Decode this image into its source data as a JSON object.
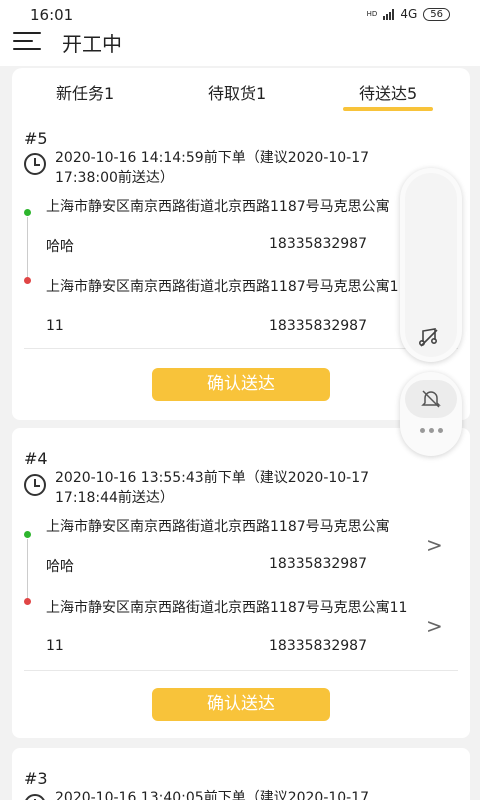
{
  "status_bar": {
    "time": "16:01",
    "hd": "HD",
    "network": "4G",
    "battery": "56"
  },
  "header": {
    "title": "开工中",
    "menu_icon": "hamburger-menu-icon"
  },
  "tabs": [
    {
      "label": "新任务1",
      "active": false
    },
    {
      "label": "待取货1",
      "active": false
    },
    {
      "label": "待送达5",
      "active": true
    }
  ],
  "orders": [
    {
      "number": "#5",
      "time_text": "2020-10-16 14:14:59前下单（建议2020-10-17 17:38:00前送达）",
      "pickup": {
        "address": "上海市静安区南京西路街道北京西路1187号马克思公寓",
        "name": "哈哈",
        "phone": "18335832987"
      },
      "delivery": {
        "address": "上海市静安区南京西路街道北京西路1187号马克思公寓11",
        "name": "11",
        "phone": "18335832987"
      },
      "button_label": "确认送达"
    },
    {
      "number": "#4",
      "time_text": "2020-10-16 13:55:43前下单（建议2020-10-17 17:18:44前送达）",
      "pickup": {
        "address": "上海市静安区南京西路街道北京西路1187号马克思公寓",
        "name": "哈哈",
        "phone": "18335832987"
      },
      "delivery": {
        "address": "上海市静安区南京西路街道北京西路1187号马克思公寓11",
        "name": "11",
        "phone": "18335832987"
      },
      "button_label": "确认送达"
    },
    {
      "number": "#3",
      "time_text": "2020-10-16 13:40:05前下单（建议2020-10-17"
    }
  ],
  "icons": {
    "chevron": ">",
    "floating": [
      "music-off-icon",
      "bell-off-icon",
      "more-icon"
    ]
  },
  "colors": {
    "accent": "#f8c33a",
    "pickup_dot": "#2db52d",
    "delivery_dot": "#e04545"
  }
}
